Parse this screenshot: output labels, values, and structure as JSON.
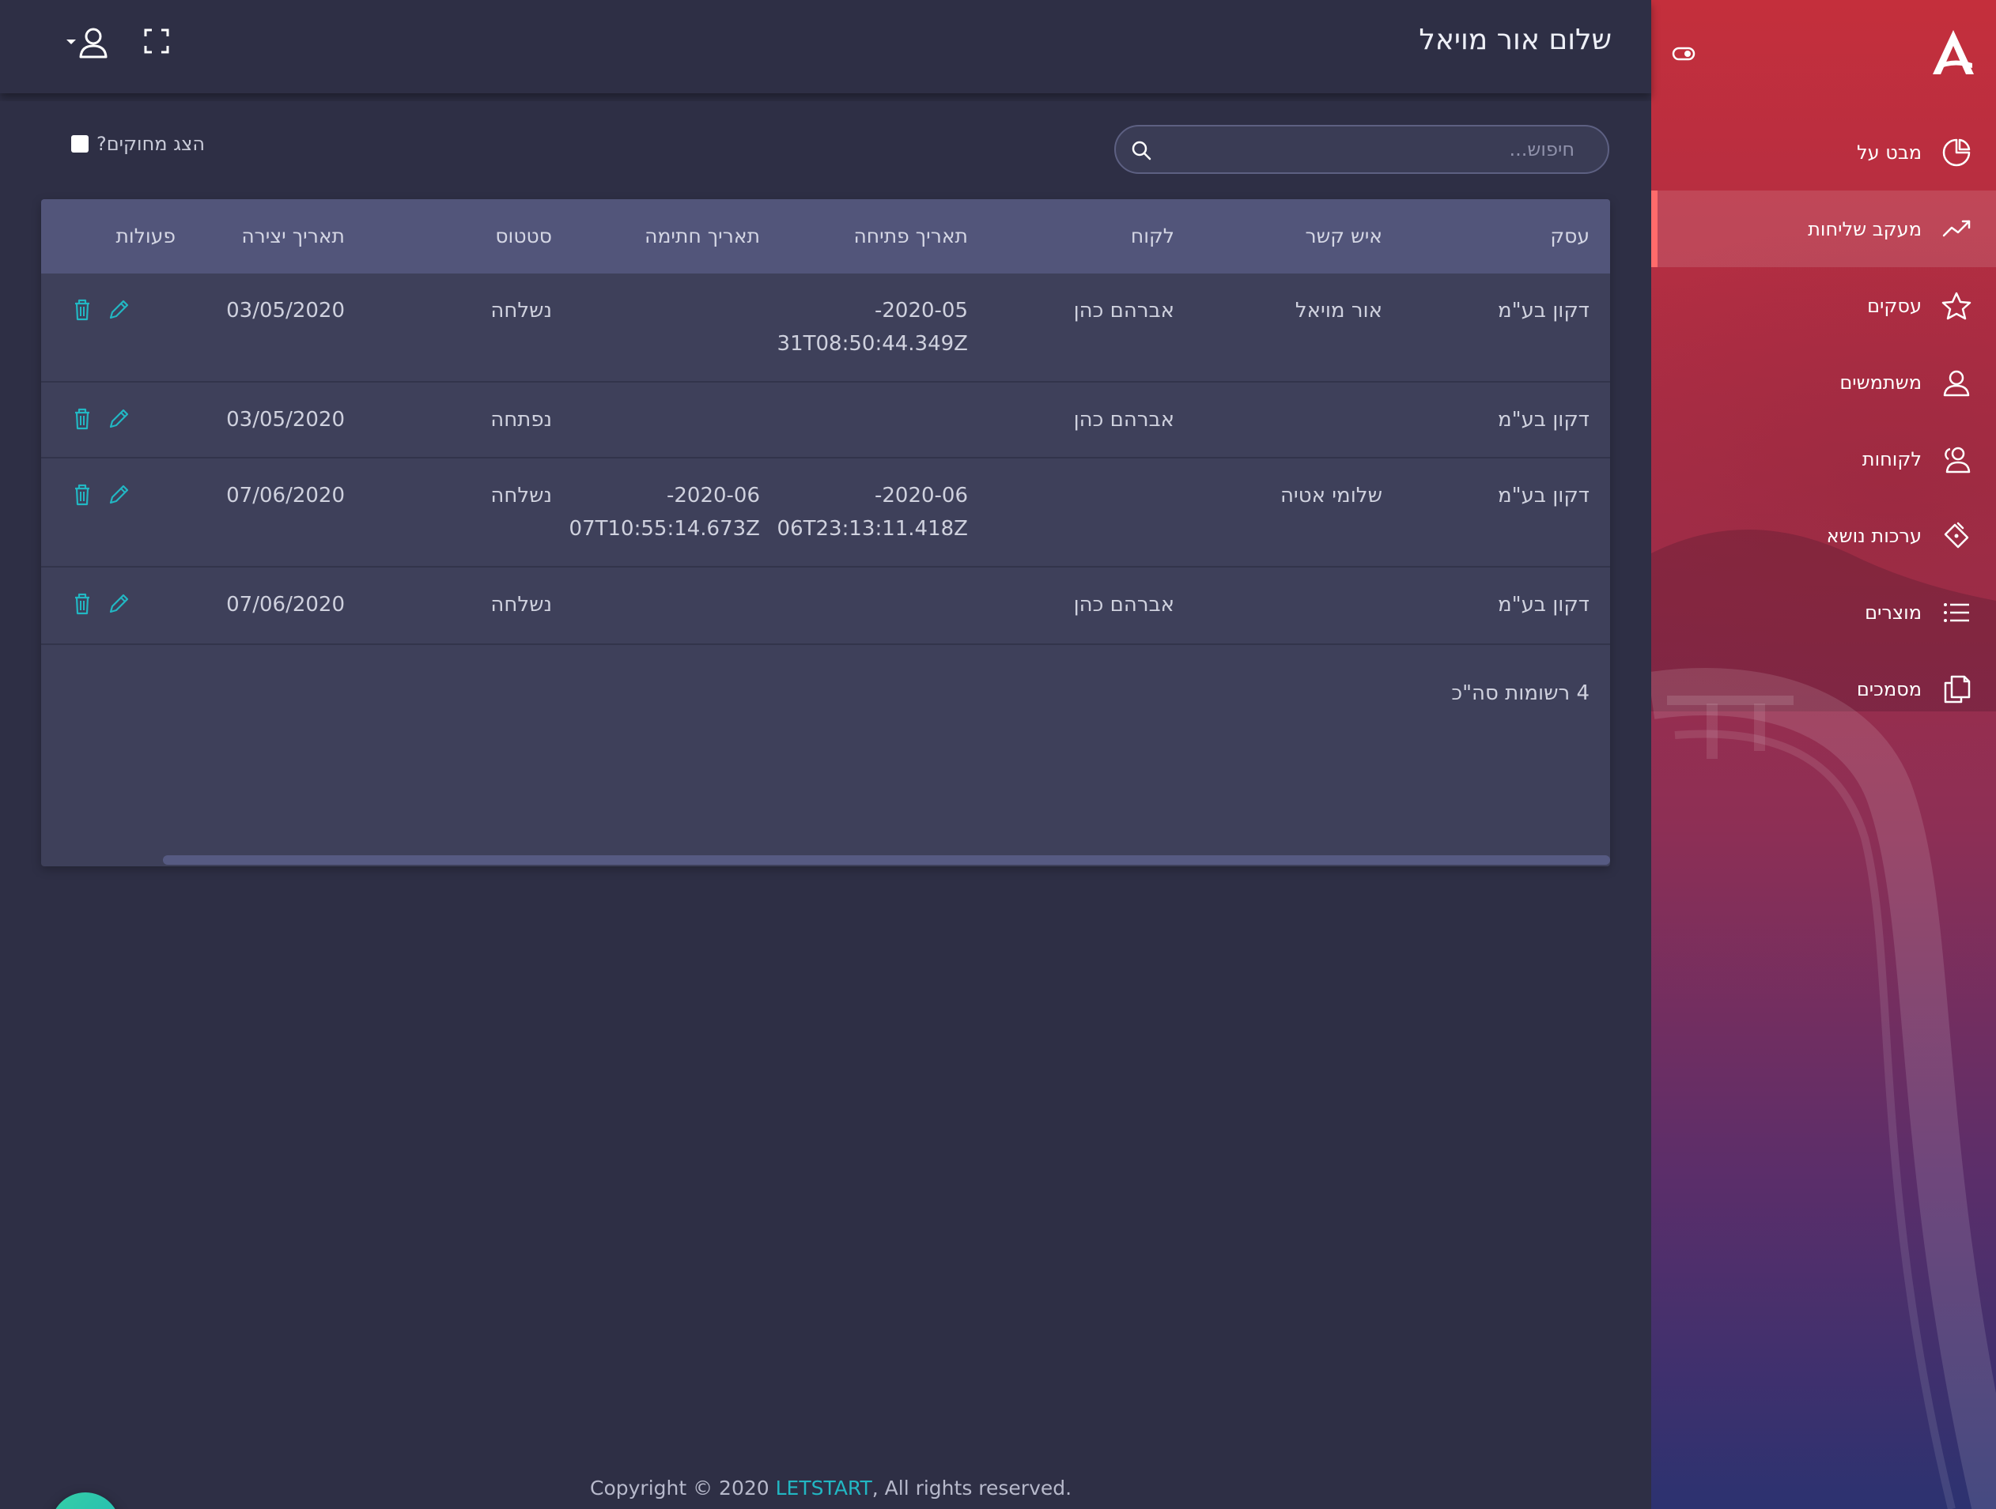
{
  "header": {
    "greeting": "שלום אור מויאל"
  },
  "sidebar": {
    "items": [
      {
        "label": "מבט על",
        "icon": "pie-chart-icon"
      },
      {
        "label": "מעקב שליחות",
        "icon": "trend-line-icon",
        "active": true
      },
      {
        "label": "עסקים",
        "icon": "star-icon"
      },
      {
        "label": "משתמשים",
        "icon": "user-icon"
      },
      {
        "label": "לקוחות",
        "icon": "users-icon"
      },
      {
        "label": "ערכות נושא",
        "icon": "paint-bucket-icon"
      },
      {
        "label": "מוצרים",
        "icon": "list-icon"
      },
      {
        "label": "מסמכים",
        "icon": "documents-icon"
      }
    ]
  },
  "toolbar": {
    "search_placeholder": "חיפוש...",
    "show_deleted_label": "הצג מחוקים?",
    "show_deleted_checked": false
  },
  "table": {
    "columns": [
      "עסק",
      "איש קשר",
      "לקוח",
      "תאריך פתיחה",
      "תאריך חתימה",
      "סטטוס",
      "תאריך יצירה",
      "פעולות"
    ],
    "rows": [
      {
        "business": "דקון בע\"מ",
        "contact": "אור מויאל",
        "customer": "אברהם כהן",
        "open_date_1": "2020-05-",
        "open_date_2": "31T08:50:44.349Z",
        "sign_date_1": "",
        "sign_date_2": "",
        "status": "נשלחה",
        "created": "03/05/2020"
      },
      {
        "business": "דקון בע\"מ",
        "contact": "",
        "customer": "אברהם כהן",
        "open_date_1": "",
        "open_date_2": "",
        "sign_date_1": "",
        "sign_date_2": "",
        "status": "נפתחה",
        "created": "03/05/2020"
      },
      {
        "business": "דקון בע\"מ",
        "contact": "שלומי אטיה",
        "customer": "",
        "open_date_1": "2020-06-",
        "open_date_2": "06T23:13:11.418Z",
        "sign_date_1": "2020-06-",
        "sign_date_2": "07T10:55:14.673Z",
        "status": "נשלחה",
        "created": "07/06/2020"
      },
      {
        "business": "דקון בע\"מ",
        "contact": "",
        "customer": "אברהם כהן",
        "open_date_1": "",
        "open_date_2": "",
        "sign_date_1": "",
        "sign_date_2": "",
        "status": "נשלחה",
        "created": "07/06/2020"
      }
    ],
    "total_label": "4 רשומות סה\"כ"
  },
  "footer": {
    "prefix": "Copyright © 2020 ",
    "brand": "LETSTART",
    "suffix": ", All rights reserved."
  },
  "colors": {
    "accent": "#22b7c3",
    "background": "#2e2f45",
    "table_header": "#52557a",
    "active_marker": "#ff6b6b"
  }
}
